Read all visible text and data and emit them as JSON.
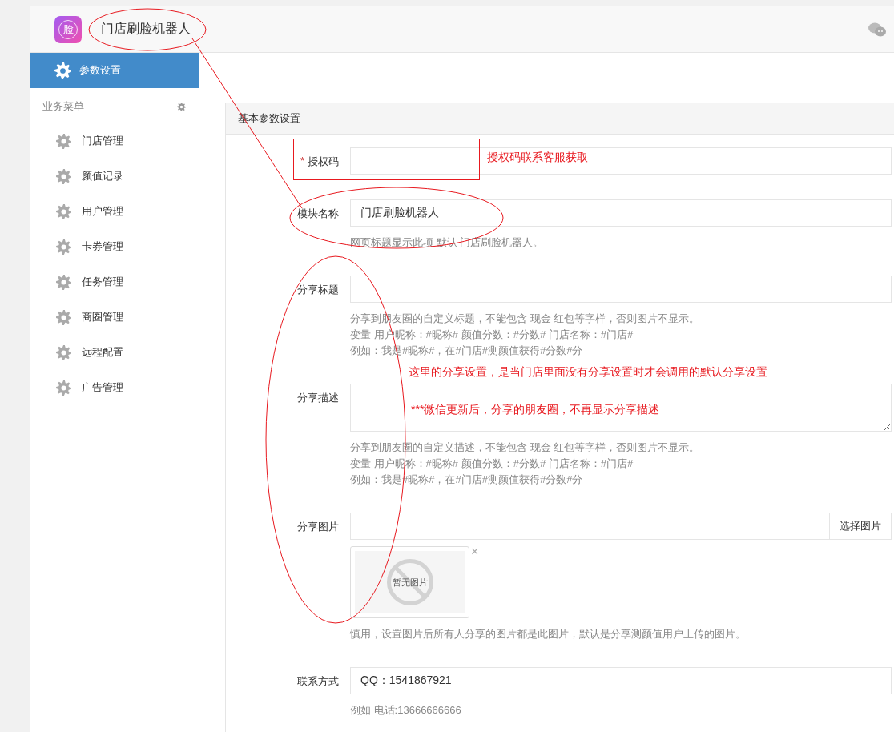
{
  "header": {
    "logo_text": "脸",
    "title": "门店刷脸机器人"
  },
  "sidebar": {
    "top_item": {
      "label": "参数设置",
      "selected": true
    },
    "section_title": "业务菜单",
    "items": [
      {
        "label": "门店管理",
        "selected": false
      },
      {
        "label": "颜值记录",
        "selected": false
      },
      {
        "label": "用户管理",
        "selected": false
      },
      {
        "label": "卡券管理",
        "selected": false
      },
      {
        "label": "任务管理",
        "selected": false
      },
      {
        "label": "商圈管理",
        "selected": false
      },
      {
        "label": "远程配置",
        "selected": false
      },
      {
        "label": "广告管理",
        "selected": false
      }
    ]
  },
  "panel": {
    "title": "基本参数设置",
    "fields": [
      {
        "kind": "text",
        "label": "授权码",
        "required_mark": "*"
      },
      {
        "kind": "text",
        "label": "模块名称",
        "value": "门店刷脸机器人",
        "help": [
          "网页标题显示此项 默认 门店刷脸机器人。"
        ]
      },
      {
        "kind": "text",
        "label": "分享标题",
        "help": [
          "分享到朋友圈的自定义标题，不能包含 现金 红包等字样，否则图片不显示。",
          "变量 用户昵称：#昵称# 颜值分数：#分数# 门店名称：#门店#",
          "例如：我是#昵称#，在#门店#测颜值获得#分数#分"
        ]
      },
      {
        "kind": "textarea",
        "label": "分享描述",
        "help": [
          "分享到朋友圈的自定义描述，不能包含 现金 红包等字样，否则图片不显示。",
          "变量 用户昵称：#昵称# 颜值分数：#分数# 门店名称：#门店#",
          "例如：我是#昵称#，在#门店#测颜值获得#分数#分"
        ]
      },
      {
        "kind": "image",
        "label": "分享图片",
        "button": "选择图片",
        "placeholder_text": "暂无图片",
        "remove": "×",
        "help": [
          "慎用，设置图片后所有人分享的图片都是此图片，默认是分享测颜值用户上传的图片。"
        ]
      },
      {
        "kind": "text",
        "label": "联系方式",
        "value": "QQ：1541867921",
        "help": [
          "例如 电话:13666666666"
        ]
      }
    ]
  },
  "annotations": {
    "notes": [
      "授权码联系客服获取",
      "这里的分享设置，是当门店里面没有分享设置时才会调用的默认分享设置",
      "***微信更新后，分享的朋友圈，不再显示分享描述"
    ]
  }
}
